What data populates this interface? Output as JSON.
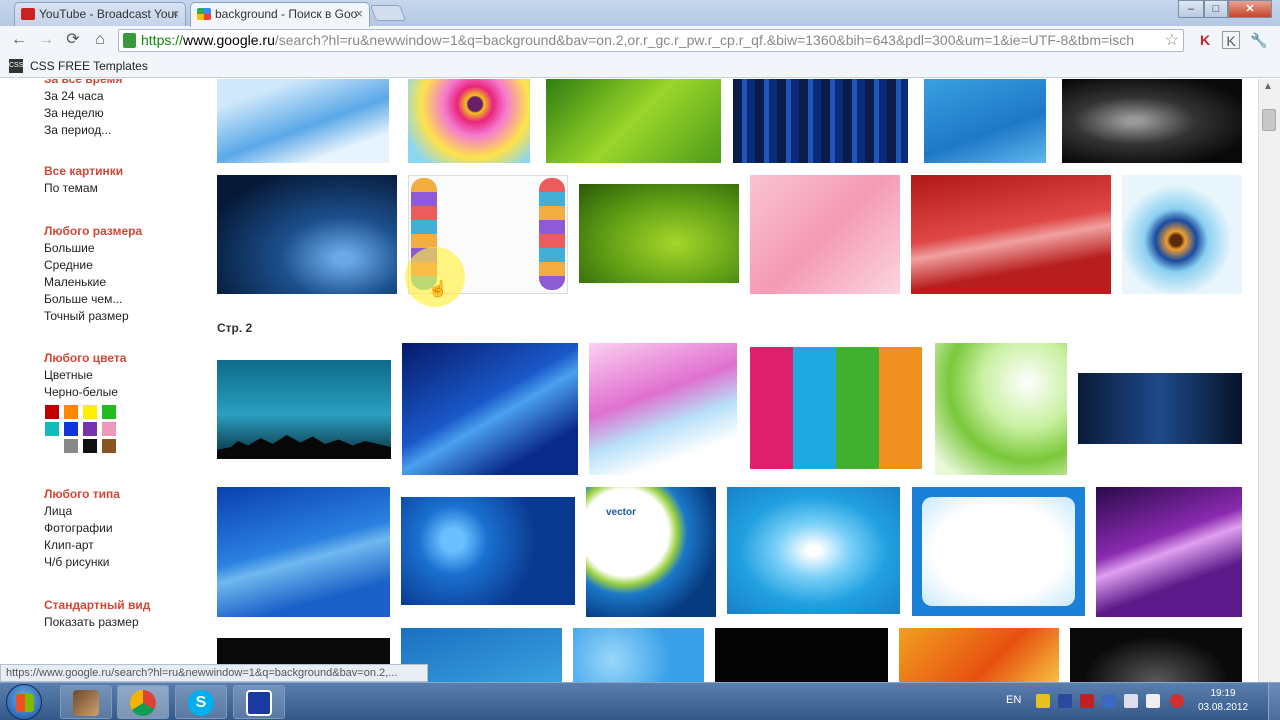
{
  "tabs": [
    {
      "title": "YouTube - Broadcast Your",
      "icon": "youtube-icon",
      "color": "#cc2222"
    },
    {
      "title": "background - Поиск в Goo",
      "icon": "google-icon",
      "color": "#3b78e7"
    }
  ],
  "address": {
    "scheme": "https://",
    "host": "www.google.ru",
    "rest": "/search?hl=ru&newwindow=1&q=background&bav=on.2,or.r_gc.r_pw.r_cp.r_qf.&biw=1360&bih=643&pdl=300&um=1&ie=UTF-8&tbm=isch"
  },
  "bookmarks": {
    "items": [
      {
        "label": "CSS FREE Templates",
        "icon_text": "CSS"
      }
    ]
  },
  "sidebar": {
    "time": {
      "partial_heading": "За все время",
      "items": [
        "За 24 часа",
        "За неделю",
        "За период..."
      ]
    },
    "type_all": {
      "heading": "Все картинки",
      "items": [
        "По темам"
      ]
    },
    "size": {
      "heading": "Любого размера",
      "items": [
        "Большие",
        "Средние",
        "Маленькие",
        "Больше чем...",
        "Точный размер"
      ]
    },
    "color": {
      "heading": "Любого цвета",
      "items": [
        "Цветные",
        "Черно-белые"
      ],
      "swatches": [
        "#c00000",
        "#ff8800",
        "#ffee00",
        "#22bb22",
        "#11bbbb",
        "#1133dd",
        "#7733aa",
        "#ee99bb",
        "#ffffff",
        "#888888",
        "#111111",
        "#885522"
      ]
    },
    "kind": {
      "heading": "Любого типа",
      "items": [
        "Лица",
        "Фотографии",
        "Клип-арт",
        "Ч/б рисунки"
      ]
    },
    "view": {
      "heading": "Стандартный вид",
      "items": [
        "Показать размер"
      ]
    }
  },
  "results": {
    "page_label": "Стр. 2",
    "vector_label": "vector"
  },
  "status_url": "https://www.google.ru/search?hl=ru&newwindow=1&q=background&bav=on.2,...",
  "taskbar": {
    "lang": "EN",
    "time": "19:19",
    "date": "03.08.2012"
  }
}
